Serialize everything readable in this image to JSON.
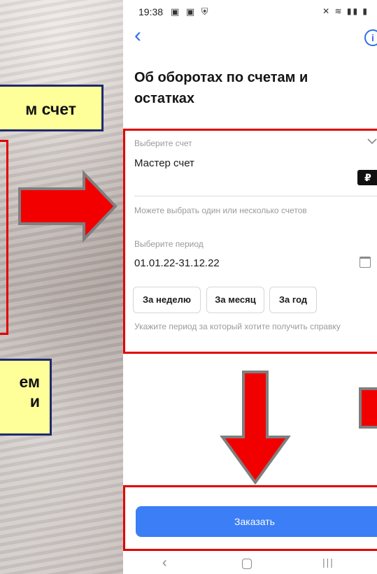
{
  "callouts": {
    "top_text": "м счет",
    "bottom_line1": "ем",
    "bottom_line2": "и"
  },
  "status_bar": {
    "time": "19:38",
    "left_icons": "▣ ▣ ⛨",
    "right_icons": "✕ ≋ ▮▮ ▮"
  },
  "nav": {
    "back_icon": "‹",
    "info_icon": "i"
  },
  "page": {
    "title": "Об оборотах по счетам и остатках"
  },
  "account_field": {
    "label": "Выберите счет",
    "value": "Мастер счет",
    "currency_badge": "₽",
    "hint": "Можете выбрать один или несколько счетов"
  },
  "period_field": {
    "label": "Выберите период",
    "value": "01.01.22-31.12.22",
    "hint": "Укажите период за который хотите получить справку"
  },
  "period_chips": [
    {
      "label": "За неделю"
    },
    {
      "label": "За месяц"
    },
    {
      "label": "За год"
    }
  ],
  "order_button": {
    "label": "Заказать"
  },
  "system_nav": {
    "back": "‹",
    "recent": "|||"
  },
  "colors": {
    "accent": "#3b7ef5",
    "highlight_border": "#e00000",
    "callout_fill": "#ffff99",
    "callout_border": "#1f2a6b"
  }
}
